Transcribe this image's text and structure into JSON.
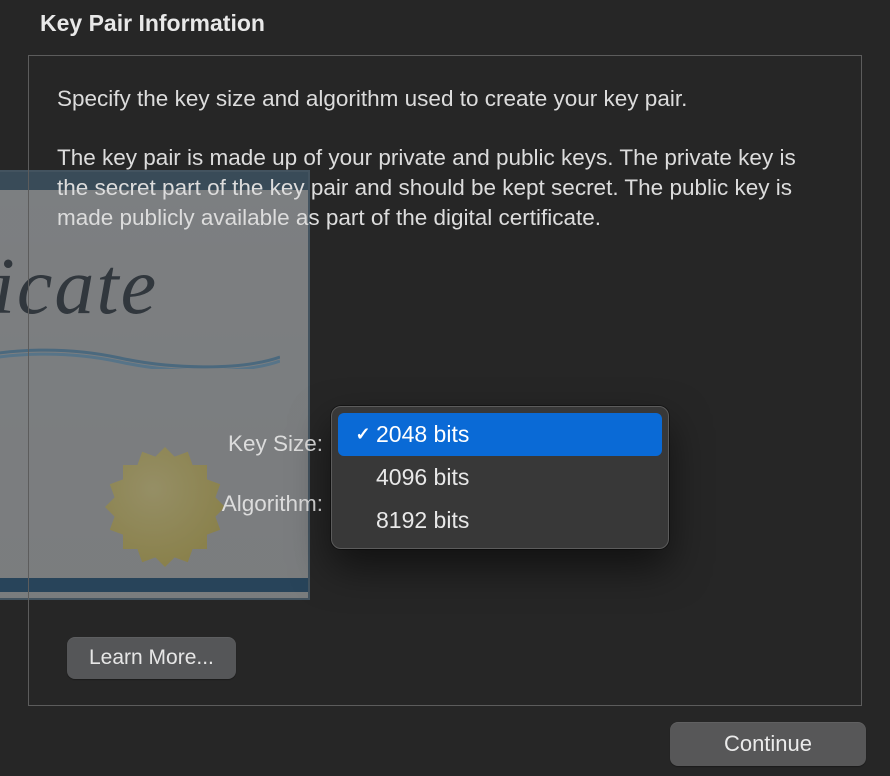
{
  "title": "Key Pair Information",
  "intro": "Specify the key size and algorithm used to create your key pair.",
  "description": "The key pair is made up of your private and public keys. The private key is the secret part of the key pair and should be kept secret. The public key is made publicly available as part of the digital certificate.",
  "form": {
    "key_size_label": "Key Size:",
    "algorithm_label": "Algorithm:"
  },
  "key_size_dropdown": {
    "options": [
      "2048 bits",
      "4096 bits",
      "8192 bits"
    ],
    "selected_index": 0
  },
  "buttons": {
    "learn_more": "Learn More...",
    "continue": "Continue"
  },
  "decor": {
    "certificate_script": "tificate"
  }
}
